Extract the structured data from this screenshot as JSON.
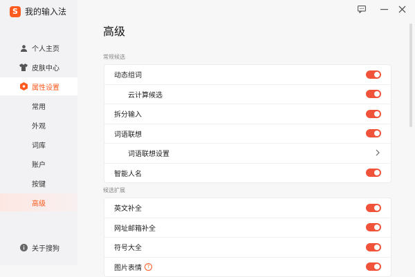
{
  "app": {
    "title": "我的输入法",
    "logo_letter": "S"
  },
  "sidebar": {
    "items": [
      {
        "label": "个人主页",
        "icon": "user-icon"
      },
      {
        "label": "皮肤中心",
        "icon": "shirt-icon"
      },
      {
        "label": "属性设置",
        "icon": "hexagon-gear-icon",
        "active": true
      }
    ],
    "subitems": [
      "常用",
      "外观",
      "词库",
      "账户",
      "按键",
      "高级"
    ],
    "active_subitem": "高级",
    "about": {
      "label": "关于搜狗",
      "icon": "info-icon"
    }
  },
  "window": {
    "feedback_icon": "chat-icon",
    "minimize_icon": "minimize-icon",
    "close_icon": "close-icon"
  },
  "main": {
    "title": "高级",
    "sections": [
      {
        "label": "常规候选",
        "rows": [
          {
            "label": "动态组词",
            "control": "toggle",
            "on": true
          },
          {
            "label": "云计算候选",
            "control": "toggle",
            "on": true,
            "sub": true
          },
          {
            "label": "拆分输入",
            "control": "toggle",
            "on": true
          },
          {
            "label": "词语联想",
            "control": "toggle",
            "on": true
          },
          {
            "label": "词语联想设置",
            "control": "chevron",
            "sub": true
          },
          {
            "label": "智能人名",
            "control": "toggle",
            "on": true
          }
        ]
      },
      {
        "label": "候选扩展",
        "rows": [
          {
            "label": "英文补全",
            "control": "toggle",
            "on": true
          },
          {
            "label": "网址邮箱补全",
            "control": "toggle",
            "on": true
          },
          {
            "label": "符号大全",
            "control": "toggle",
            "on": true
          },
          {
            "label": "图片表情",
            "control": "toggle",
            "on": true,
            "help": "?"
          }
        ]
      }
    ]
  },
  "colors": {
    "accent": "#ff5a1f",
    "toggle_on": "#f0533a"
  }
}
